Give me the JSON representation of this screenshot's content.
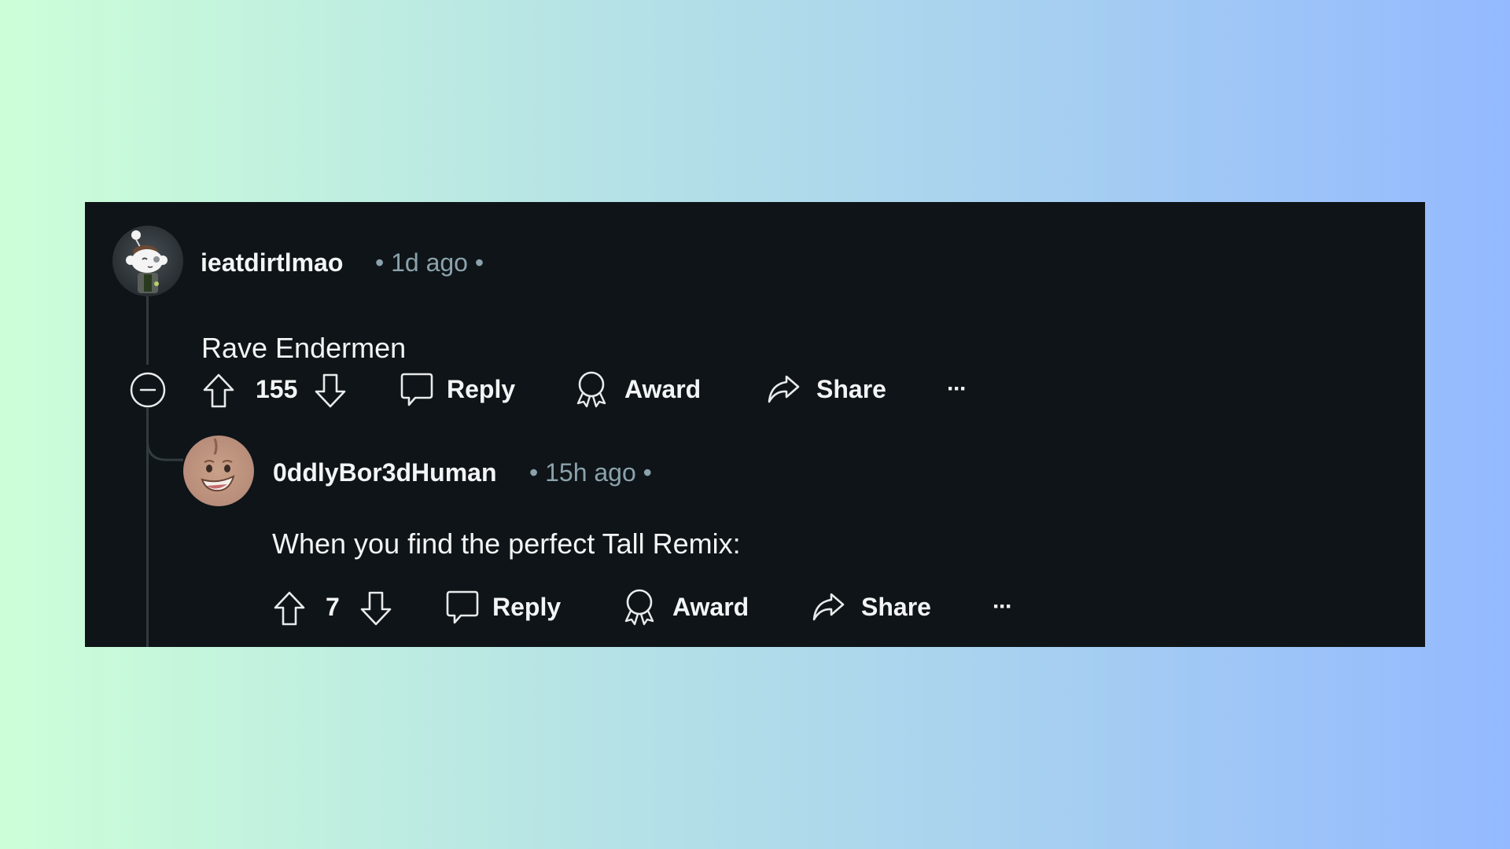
{
  "comments": [
    {
      "username": "ieatdirtlmao",
      "meta": "• 1d ago •",
      "body": "Rave Endermen",
      "votes": "155",
      "actions": {
        "reply": "Reply",
        "award": "Award",
        "share": "Share",
        "more": "···"
      }
    },
    {
      "username": "0ddlyBor3dHuman",
      "meta": "• 15h ago •",
      "body": "When you find the perfect Tall Remix:",
      "votes": "7",
      "actions": {
        "reply": "Reply",
        "award": "Award",
        "share": "Share",
        "more": "···"
      }
    }
  ],
  "colors": {
    "card_bg": "#0e1417",
    "text": "#f2f4f5",
    "meta_text": "#8ba2ad",
    "thread_line": "#333b40",
    "bg_gradient_start": "#ccffd8",
    "bg_gradient_end": "#94b9ff"
  }
}
